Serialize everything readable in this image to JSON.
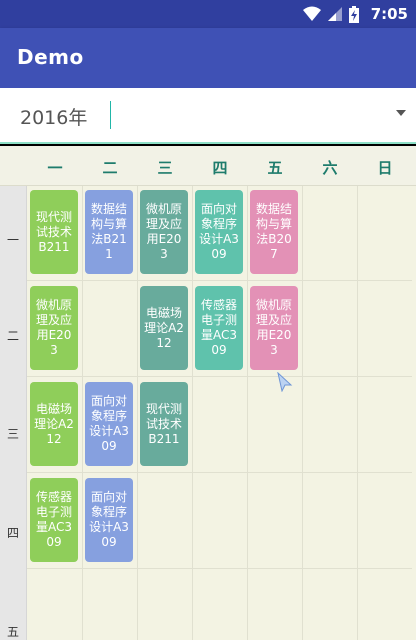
{
  "status_bar": {
    "time": "7:05"
  },
  "app_bar": {
    "title": "Demo"
  },
  "year_selector": {
    "value": "2016年"
  },
  "week_days": [
    "一",
    "二",
    "三",
    "四",
    "五",
    "六",
    "日"
  ],
  "row_labels": [
    "一",
    "二",
    "三",
    "四",
    "五"
  ],
  "colors": {
    "green": "#8fce5a",
    "blue": "#86a0df",
    "teal": "#68ab9c",
    "mint": "#5fc2ac",
    "pink": "#e391b6",
    "accent": "#3f51b5"
  },
  "courses": [
    {
      "day": 0,
      "row": 0,
      "text": "现代测试技术B211",
      "color": "green"
    },
    {
      "day": 1,
      "row": 0,
      "text": "数据结构与算法B211",
      "color": "blue"
    },
    {
      "day": 2,
      "row": 0,
      "text": "微机原理及应用E203",
      "color": "teal"
    },
    {
      "day": 3,
      "row": 0,
      "text": "面向对象程序设计A309",
      "color": "mint"
    },
    {
      "day": 4,
      "row": 0,
      "text": "数据结构与算法B207",
      "color": "pink"
    },
    {
      "day": 0,
      "row": 1,
      "text": "微机原理及应用E203",
      "color": "green"
    },
    {
      "day": 2,
      "row": 1,
      "text": "电磁场理论A212",
      "color": "teal"
    },
    {
      "day": 3,
      "row": 1,
      "text": "传感器电子测量AC309",
      "color": "mint"
    },
    {
      "day": 4,
      "row": 1,
      "text": "微机原理及应用E203",
      "color": "pink"
    },
    {
      "day": 0,
      "row": 2,
      "text": "电磁场理论A212",
      "color": "green"
    },
    {
      "day": 1,
      "row": 2,
      "text": "面向对象程序设计A309",
      "color": "blue"
    },
    {
      "day": 2,
      "row": 2,
      "text": "现代测试技术B211",
      "color": "teal"
    },
    {
      "day": 0,
      "row": 3,
      "text": "传感器电子测量AC309",
      "color": "green"
    },
    {
      "day": 1,
      "row": 3,
      "text": "面向对象程序设计A309",
      "color": "blue"
    }
  ]
}
